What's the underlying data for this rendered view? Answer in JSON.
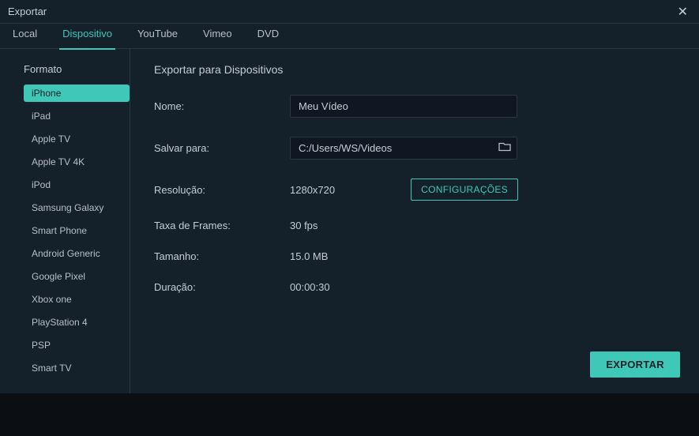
{
  "titlebar": {
    "title": "Exportar"
  },
  "tabs": [
    {
      "label": "Local",
      "active": false
    },
    {
      "label": "Dispositivo",
      "active": true
    },
    {
      "label": "YouTube",
      "active": false
    },
    {
      "label": "Vimeo",
      "active": false
    },
    {
      "label": "DVD",
      "active": false
    }
  ],
  "sidebar": {
    "heading": "Formato",
    "items": [
      {
        "label": "iPhone",
        "active": true
      },
      {
        "label": "iPad",
        "active": false
      },
      {
        "label": "Apple TV",
        "active": false
      },
      {
        "label": "Apple TV 4K",
        "active": false
      },
      {
        "label": "iPod",
        "active": false
      },
      {
        "label": "Samsung Galaxy",
        "active": false
      },
      {
        "label": "Smart Phone",
        "active": false
      },
      {
        "label": "Android Generic",
        "active": false
      },
      {
        "label": "Google Pixel",
        "active": false
      },
      {
        "label": "Xbox one",
        "active": false
      },
      {
        "label": "PlayStation 4",
        "active": false
      },
      {
        "label": "PSP",
        "active": false
      },
      {
        "label": "Smart TV",
        "active": false
      }
    ]
  },
  "main": {
    "section_title": "Exportar para Dispositivos",
    "name_label": "Nome:",
    "name_value": "Meu Vídeo",
    "save_label": "Salvar para:",
    "save_value": "C:/Users/WS/Videos",
    "resolution_label": "Resolução:",
    "resolution_value": "1280x720",
    "settings_button": "CONFIGURAÇÕES",
    "framerate_label": "Taxa de Frames:",
    "framerate_value": "30 fps",
    "size_label": "Tamanho:",
    "size_value": "15.0 MB",
    "duration_label": "Duração:",
    "duration_value": "00:00:30",
    "export_button": "EXPORTAR"
  }
}
